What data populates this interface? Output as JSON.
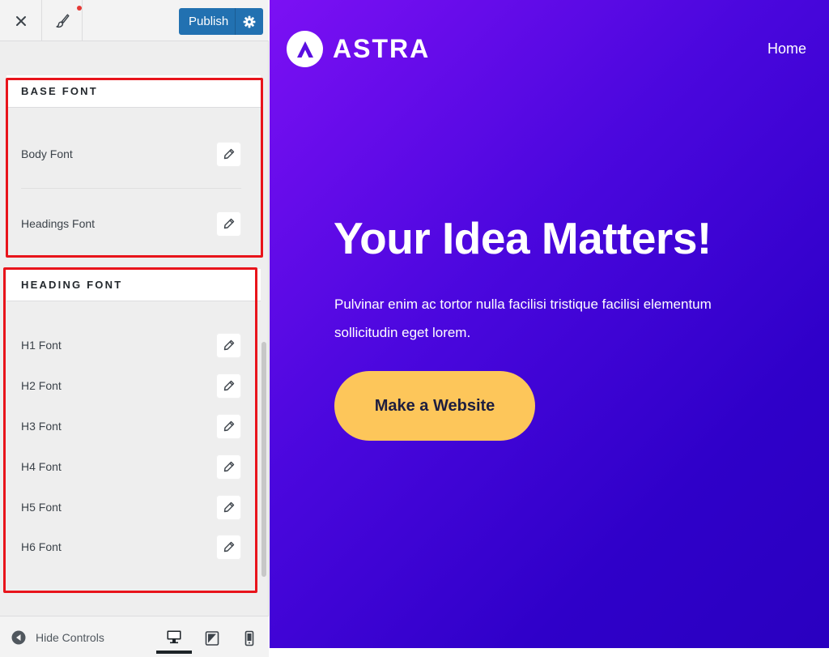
{
  "topbar": {
    "close_icon": "close-icon",
    "brush_icon": "paintbrush-icon",
    "publish_label": "Publish",
    "settings_icon": "gear-icon",
    "publish_color": "#2271b1",
    "notify_color": "#e53935"
  },
  "sections": {
    "base": {
      "title": "BASE FONT",
      "items": [
        {
          "label": "Body Font"
        },
        {
          "label": "Headings Font"
        }
      ]
    },
    "heading": {
      "title": "HEADING FONT",
      "items": [
        {
          "label": "H1 Font"
        },
        {
          "label": "H2 Font"
        },
        {
          "label": "H3 Font"
        },
        {
          "label": "H4 Font"
        },
        {
          "label": "H5 Font"
        },
        {
          "label": "H6 Font"
        }
      ]
    },
    "edit_icon": "pencil-icon",
    "highlight_color": "#e8141b"
  },
  "footer": {
    "hide_label": "Hide Controls",
    "hide_icon": "arrow-left-circle-icon",
    "devices": [
      "desktop-icon",
      "tablet-icon",
      "mobile-icon"
    ],
    "active_device": "desktop"
  },
  "preview": {
    "logo_text": "ASTRA",
    "nav_home": "Home",
    "hero_title": "Your Idea Matters!",
    "hero_text": "Pulvinar enim ac tortor nulla facilisi tristique facilisi elementum sollicitudin eget lorem.",
    "cta_label": "Make a Website",
    "gradient_start": "#7c10f4",
    "gradient_end": "#2a00c0",
    "cta_color": "#fdc65a"
  }
}
